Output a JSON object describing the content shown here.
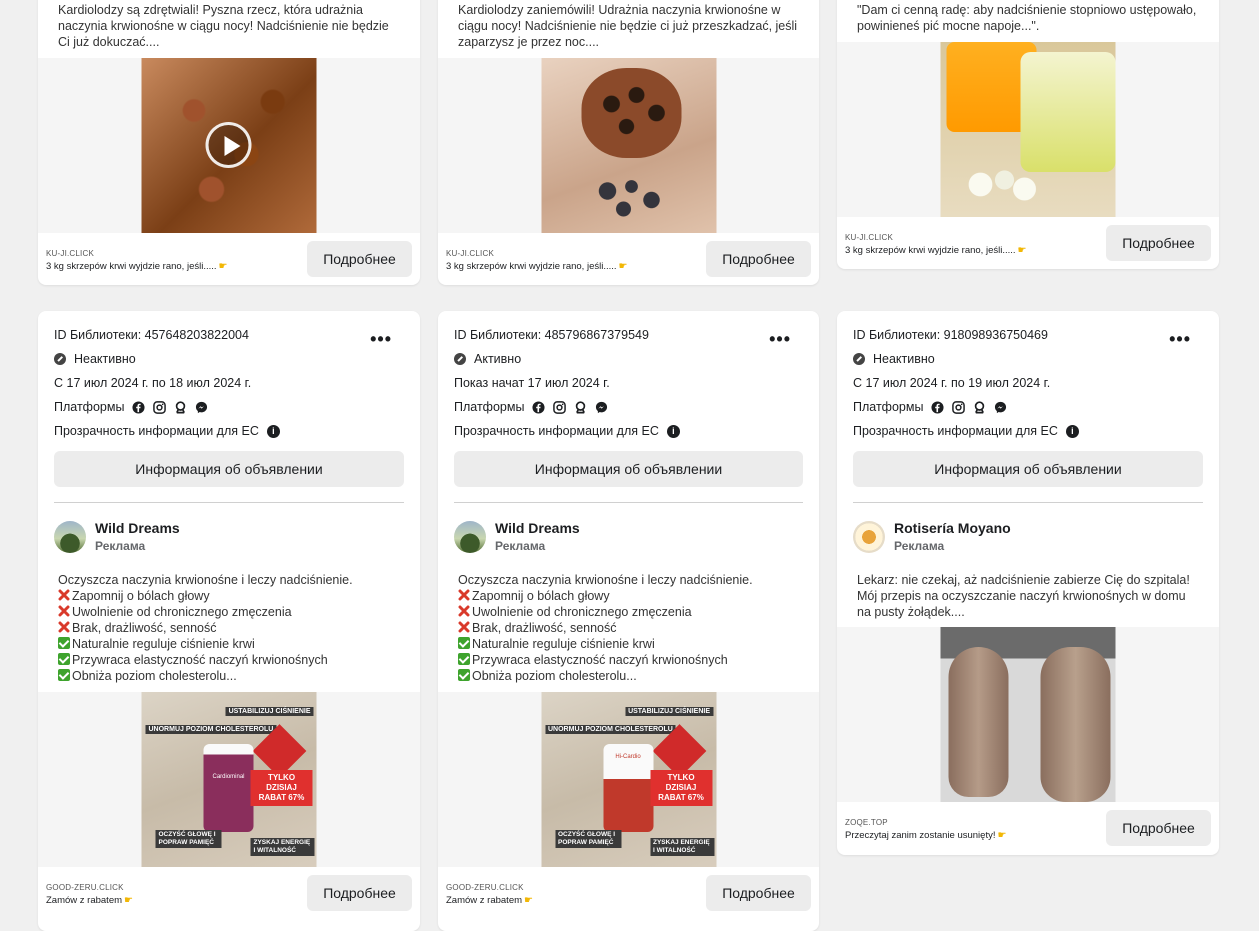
{
  "top_cards": [
    {
      "text": "Kardiolodzy są zdrętwiali! Pyszna rzecz, która udrażnia naczynia krwionośne w ciągu nocy! Nadciśnienie nie będzie Ci już dokuczać....",
      "domain": "KU-JI.CLICK",
      "description": "3 kg skrzepów krwi wyjdzie rano, jeśli.....",
      "cta": "Подробнее"
    },
    {
      "text": "Kardiolodzy zaniemówili! Udrażnia naczynia krwionośne w ciągu nocy! Nadciśnienie nie będzie ci już przeszkadzać, jeśli zaparzysz je przez noc....",
      "domain": "KU-JI.CLICK",
      "description": "3 kg skrzepów krwi wyjdzie rano, jeśli.....",
      "cta": "Подробнее"
    },
    {
      "text": "\"Dam ci cenną radę: aby nadciśnienie stopniowo ustępowało, powinieneś pić mocne napoje...\".",
      "domain": "KU-JI.CLICK",
      "description": "3 kg skrzepów krwi wyjdzie rano, jeśli.....",
      "cta": "Подробнее"
    }
  ],
  "cards": [
    {
      "library_id": "ID Библиотеки: 457648203822004",
      "status": "Неактивно",
      "dates": "С 17 июл 2024 г. по 18 июл 2024 г.",
      "platforms_label": "Платформы",
      "transparency": "Прозрачность информации для ЕС",
      "info_button": "Информация об объявлении",
      "advertiser": "Wild Dreams",
      "sponsored": "Реклама",
      "lines": [
        {
          "icon": "",
          "text": "Oczyszcza naczynia krwionośne i leczy nadciśnienie."
        },
        {
          "icon": "x",
          "text": "Zapomnij o bólach głowy"
        },
        {
          "icon": "x",
          "text": "Uwolnienie od chronicznego zmęczenia"
        },
        {
          "icon": "x",
          "text": "Brak, drażliwość, senność"
        },
        {
          "icon": "check",
          "text": "Naturalnie reguluje ciśnienie krwi"
        },
        {
          "icon": "check",
          "text": "Przywraca elastyczność naczyń krwionośnych"
        },
        {
          "icon": "check",
          "text": "Obniża poziom cholesterolu..."
        }
      ],
      "domain": "GOOD-ZERU.CLICK",
      "description": "Zamów z rabatem",
      "cta": "Подробнее",
      "banner": {
        "t1": "USTABILIZUJ CIŚNIENIE",
        "t2": "UNORMUJ POZIOM CHOLESTEROLU",
        "t3": "TYLKO DZISIAJ RABAT 67%",
        "t4": "OCZYŚĆ GŁOWĘ I POPRAW PAMIĘĆ",
        "t5": "ZYSKAJ ENERGIĘ I WITALNOŚĆ",
        "product": "Cardiominal"
      }
    },
    {
      "library_id": "ID Библиотеки: 485796867379549",
      "status": "Активно",
      "dates": "Показ начат 17 июл 2024 г.",
      "platforms_label": "Платформы",
      "transparency": "Прозрачность информации для ЕС",
      "info_button": "Информация об объявлении",
      "advertiser": "Wild Dreams",
      "sponsored": "Реклама",
      "lines": [
        {
          "icon": "",
          "text": "Oczyszcza naczynia krwionośne i leczy nadciśnienie."
        },
        {
          "icon": "x",
          "text": "Zapomnij o bólach głowy"
        },
        {
          "icon": "x",
          "text": "Uwolnienie od chronicznego zmęczenia"
        },
        {
          "icon": "x",
          "text": "Brak, drażliwość, senność"
        },
        {
          "icon": "check",
          "text": "Naturalnie reguluje ciśnienie krwi"
        },
        {
          "icon": "check",
          "text": "Przywraca elastyczność naczyń krwionośnych"
        },
        {
          "icon": "check",
          "text": "Obniża poziom cholesterolu..."
        }
      ],
      "domain": "GOOD-ZERU.CLICK",
      "description": "Zamów z rabatem",
      "cta": "Подробнее",
      "banner": {
        "t1": "USTABILIZUJ CIŚNIENIE",
        "t2": "UNORMUJ POZIOM CHOLESTEROLU",
        "t3": "TYLKO DZISIAJ RABAT 67%",
        "t4": "OCZYŚĆ GŁOWĘ I POPRAW PAMIĘĆ",
        "t5": "ZYSKAJ ENERGIĘ I WITALNOŚĆ",
        "product": "Hi-Cardio"
      }
    },
    {
      "library_id": "ID Библиотеки: 918098936750469",
      "status": "Неактивно",
      "dates": "С 17 июл 2024 г. по 19 июл 2024 г.",
      "platforms_label": "Платформы",
      "transparency": "Прозрачность информации для ЕС",
      "info_button": "Информация об объявлении",
      "advertiser": "Rotisería Moyano",
      "sponsored": "Реклама",
      "lines": [
        {
          "icon": "",
          "text": "Lekarz: nie czekaj, aż nadciśnienie zabierze Cię do szpitala! Mój przepis na oczyszczanie naczyń krwionośnych w domu na pusty żołądek...."
        }
      ],
      "domain": "ZOQE.TOP",
      "description": "Przeczytaj zanim zostanie usunięty!",
      "cta": "Подробнее"
    }
  ],
  "colors": {
    "page_bg": "#f0f0f0",
    "card_bg": "#ffffff",
    "button_bg": "#ececec",
    "x_red": "#d93a2b",
    "check_green": "#3ea32d",
    "banner_red": "#e0302e"
  }
}
